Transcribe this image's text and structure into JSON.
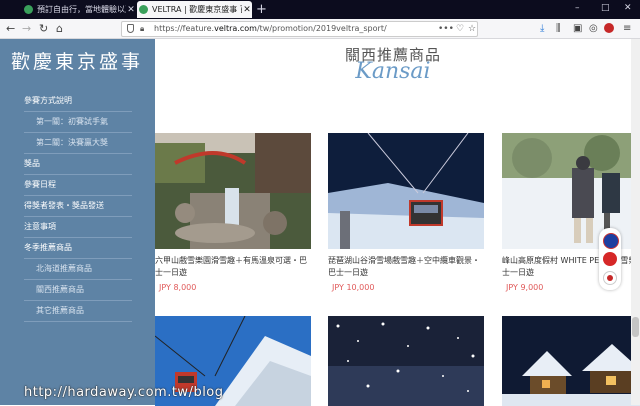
{
  "browser": {
    "tabs": [
      {
        "title": "預訂自由行，當地體驗以及觀光",
        "active": false,
        "favicon_color": "#3aa05b"
      },
      {
        "title": "VELTRA | 歡慶東京盛事 百萬獎",
        "active": true,
        "favicon_color": "#3aa05b"
      }
    ],
    "new_tab": "+",
    "url_prefix": "https://feature.",
    "url_domain": "veltra.com",
    "url_path": "/tw/promotion/2019veltra_sport/",
    "controls": {
      "minimize": "–",
      "maximize": "□",
      "close": "✕"
    }
  },
  "sidebar": {
    "brand": "歡慶東京盛事",
    "items": [
      {
        "label": "參賽方式說明",
        "sub": false
      },
      {
        "label": "第一關：初賽試手氣",
        "sub": true
      },
      {
        "label": "第二關：決賽贏大獎",
        "sub": true
      },
      {
        "label": "獎品",
        "sub": false
      },
      {
        "label": "參賽日程",
        "sub": false
      },
      {
        "label": "得獎者發表・獎品發送",
        "sub": false
      },
      {
        "label": "注意事項",
        "sub": false
      },
      {
        "label": "冬季推薦商品",
        "sub": false
      },
      {
        "label": "北海道推薦商品",
        "sub": true
      },
      {
        "label": "關西推薦商品",
        "sub": true
      },
      {
        "label": "其它推薦商品",
        "sub": true
      }
    ]
  },
  "main": {
    "title": "關西推薦商品",
    "subtitle": "Kansai",
    "products": [
      {
        "name": "六甲山戲雪樂園滑雪趣＋有馬溫泉可選・巴士一日遊",
        "price": "JPY  8,000"
      },
      {
        "name": "琵琶湖山谷滑雪場戲雪趣＋空中纜車觀景・巴士一日遊",
        "price": "JPY  10,000"
      },
      {
        "name": "峰山高原度假村 WHITE PEAK 滑雪樂・巴士一日遊",
        "price": "JPY  9,000"
      }
    ]
  },
  "watermark": "http://hardaway.com.tw/blog"
}
